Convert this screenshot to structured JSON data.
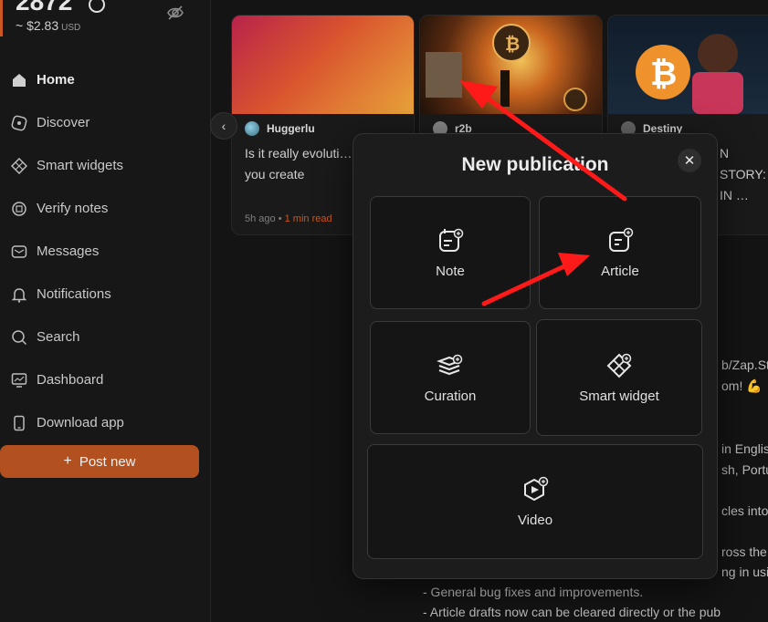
{
  "balance": {
    "amount": "2872",
    "usd": "~ $2.83",
    "currency": "USD"
  },
  "sidebar": {
    "items": [
      {
        "label": "Home",
        "icon": "home-icon",
        "active": true
      },
      {
        "label": "Discover",
        "icon": "compass-icon"
      },
      {
        "label": "Smart widgets",
        "icon": "widget-icon"
      },
      {
        "label": "Verify notes",
        "icon": "verify-icon"
      },
      {
        "label": "Messages",
        "icon": "message-icon"
      },
      {
        "label": "Notifications",
        "icon": "bell-icon"
      },
      {
        "label": "Search",
        "icon": "search-icon"
      },
      {
        "label": "Dashboard",
        "icon": "dashboard-icon"
      },
      {
        "label": "Download app",
        "icon": "phone-icon"
      }
    ],
    "post_new": "Post new"
  },
  "cards": [
    {
      "author": "Huggerlu",
      "title": "Is it really evoluti… when you create",
      "time": "5h ago",
      "read": "1 min read"
    },
    {
      "author": "r2b"
    },
    {
      "author": "Destiny",
      "title": "N STORY: IN …"
    }
  ],
  "background_text": [
    "b/Zap.St",
    "om! 💪",
    "in Englis",
    "sh, Portu",
    "cles into",
    "ross the",
    "ng in usi",
    "- General bug fixes and improvements.",
    "- Article drafts now can be cleared directly or the pub"
  ],
  "modal": {
    "title": "New publication",
    "options": [
      {
        "label": "Note",
        "icon": "note-icon"
      },
      {
        "label": "Article",
        "icon": "article-icon"
      },
      {
        "label": "Curation",
        "icon": "curation-icon"
      },
      {
        "label": "Smart widget",
        "icon": "smart-widget-icon"
      },
      {
        "label": "Video",
        "icon": "video-icon"
      }
    ]
  },
  "colors": {
    "accent": "#c9571f",
    "annotation": "#ff1a1a"
  }
}
